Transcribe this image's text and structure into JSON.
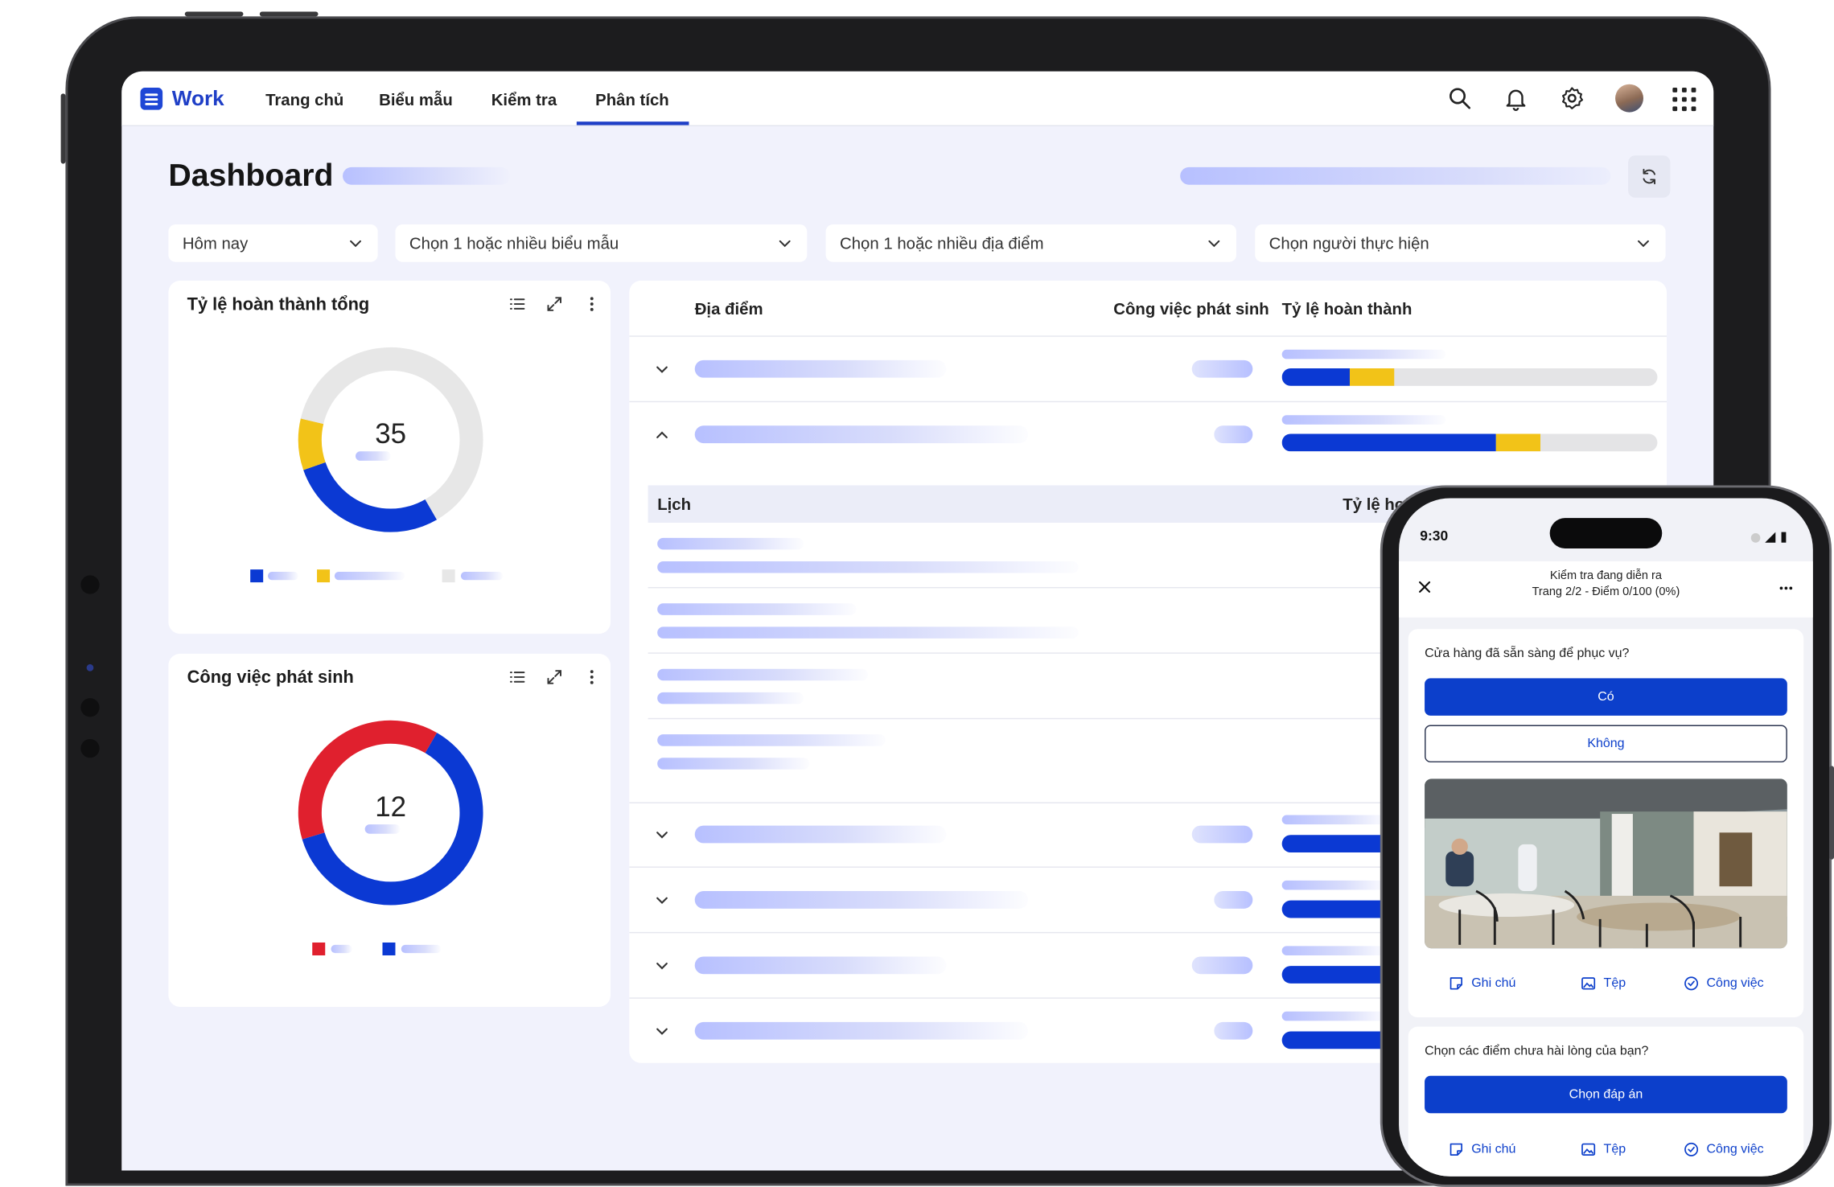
{
  "app": {
    "brand": "Work"
  },
  "nav": {
    "items": [
      "Trang chủ",
      "Biểu mẫu",
      "Kiểm tra",
      "Phân tích"
    ],
    "active": "Phân tích"
  },
  "toolbar": {
    "icons": [
      "search-icon",
      "bell-icon",
      "gear-icon",
      "avatar",
      "apps-grid-icon"
    ]
  },
  "page": {
    "title": "Dashboard"
  },
  "filters": {
    "date": "Hôm nay",
    "forms": "Chọn 1 hoặc nhiều biểu mẫu",
    "locations": "Chọn 1 hoặc nhiều địa điểm",
    "assignee": "Chọn người thực hiện"
  },
  "completion_card": {
    "title": "Tỷ lệ hoàn thành tổng",
    "value": "35",
    "chart_data": {
      "type": "pie",
      "values": [
        0.28,
        0.09,
        0.63
      ],
      "colors": [
        "#0b39d3",
        "#f2c318",
        "#e7e7e7"
      ]
    }
  },
  "issues_card": {
    "title": "Công việc phát sinh",
    "value": "12",
    "chart_data": {
      "type": "pie",
      "values": [
        0.62,
        0.38
      ],
      "colors": [
        "#0b39d3",
        "#e0202e"
      ]
    }
  },
  "table": {
    "headers": {
      "location": "Địa điểm",
      "issues": "Công việc phát sinh",
      "rate": "Tỷ lệ hoàn thành"
    },
    "sub_headers": {
      "schedule": "Lịch",
      "rate": "Tỷ lệ hoàn thành"
    },
    "rows": [
      {
        "expanded": false,
        "blue": 0.18,
        "yellow": 0.12
      },
      {
        "expanded": true,
        "blue": 0.57,
        "yellow": 0.12
      },
      {
        "expanded": false
      },
      {
        "expanded": false
      },
      {
        "expanded": false
      },
      {
        "expanded": false
      }
    ],
    "colors": {
      "blue": "#0b39d3",
      "yellow": "#f2c318",
      "track": "#e4e4e6"
    }
  },
  "phone": {
    "time": "9:30",
    "header_title": "Kiểm tra đang diễn ra",
    "header_sub": "Trang 2/2 - Điểm 0/100 (0%)",
    "q1": "Cửa hàng đã sẵn sàng để phục vụ?",
    "yes": "Có",
    "no": "Không",
    "actions": {
      "note": "Ghi chú",
      "file": "Tệp",
      "task": "Công việc"
    },
    "q2": "Chọn các điểm chưa hài lòng của bạn?",
    "choose": "Chọn đáp án"
  }
}
